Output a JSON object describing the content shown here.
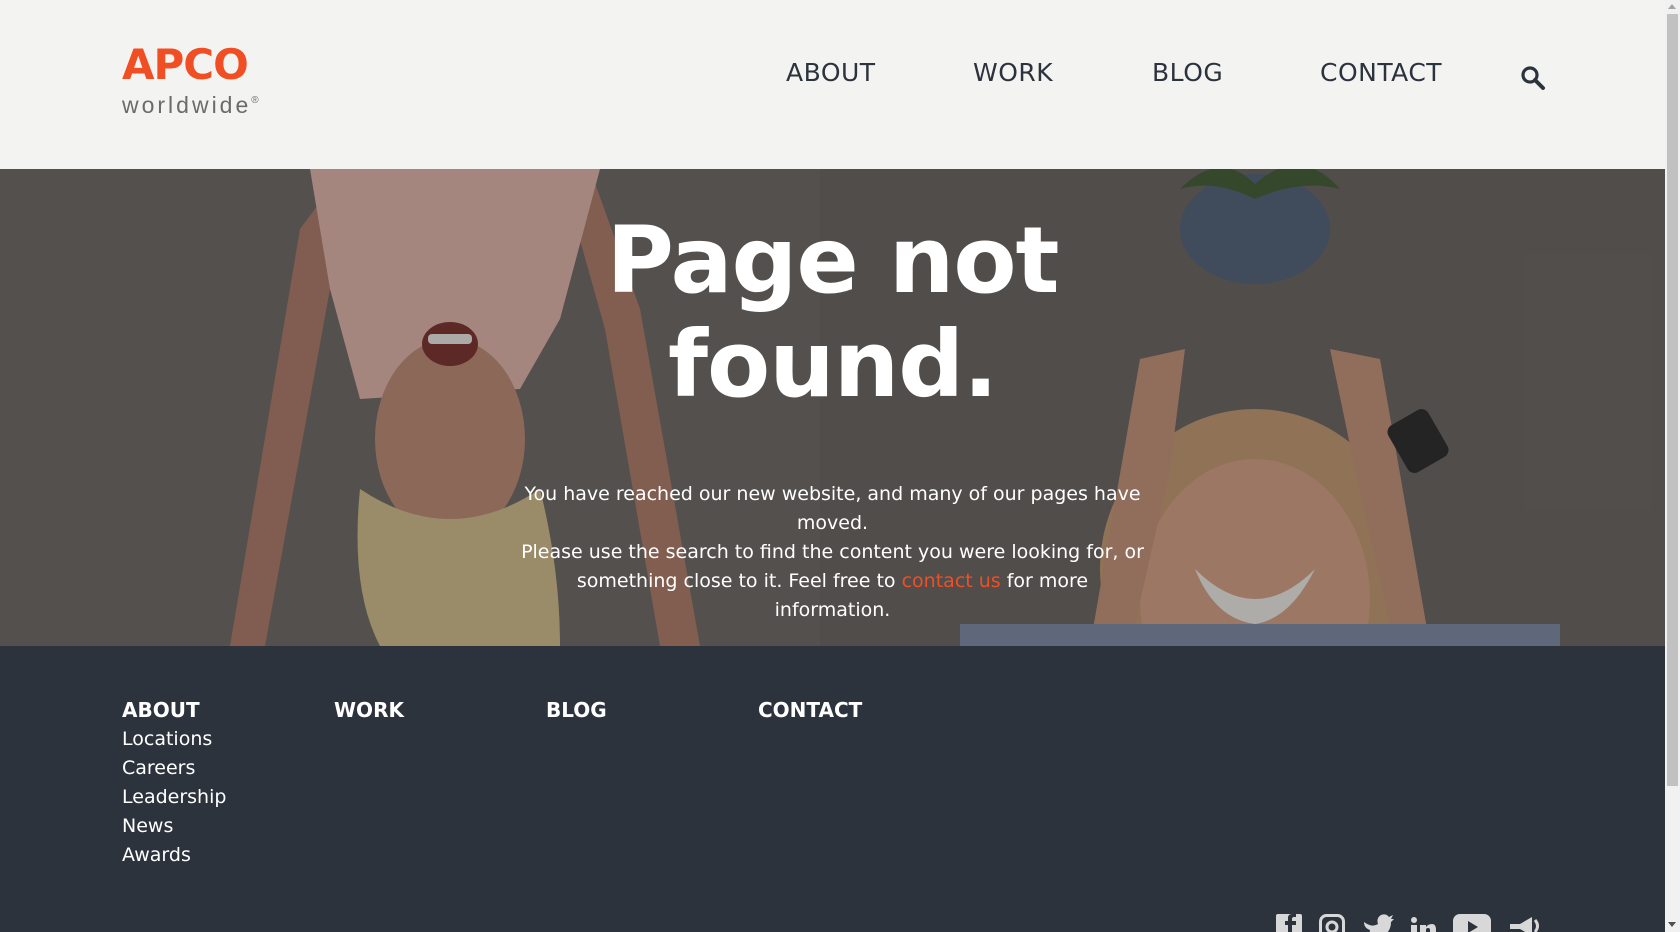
{
  "header": {
    "logo_main": "APCO",
    "logo_sub": "worldwide",
    "logo_reg": "®",
    "nav": [
      "ABOUT",
      "WORK",
      "BLOG",
      "CONTACT"
    ],
    "search_icon": "search-icon"
  },
  "hero": {
    "title_line1": "Page not",
    "title_line2": "found.",
    "text_line1": "You have reached our new website, and many of our pages have moved.",
    "text_line2_a": "Please use the search to find the content you were looking for, or something close to it. Feel free to ",
    "text_link": "contact us",
    "text_line2_b": " for more information."
  },
  "footer": {
    "columns": [
      {
        "heading": "ABOUT",
        "links": [
          "Locations",
          "Careers",
          "Leadership",
          "News",
          "Awards"
        ]
      },
      {
        "heading": "WORK",
        "links": []
      },
      {
        "heading": "BLOG",
        "links": []
      },
      {
        "heading": "CONTACT",
        "links": []
      }
    ],
    "social_icons": [
      "facebook-icon",
      "instagram-icon",
      "twitter-icon",
      "linkedin-icon",
      "youtube-icon",
      "podcast-icon"
    ]
  },
  "colors": {
    "brand_orange": "#f04f23",
    "header_bg": "#f3f3f1",
    "footer_bg": "#2d333c",
    "nav_text": "#2d333c"
  }
}
